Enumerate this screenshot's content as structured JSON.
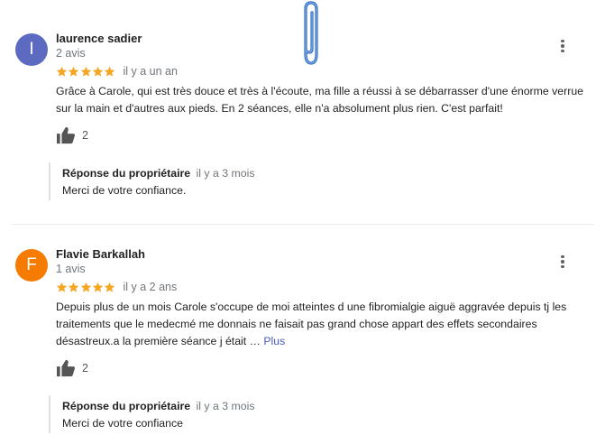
{
  "colors": {
    "avatar_1": "#5c6bc0",
    "avatar_2": "#f57c00",
    "stars": "#f5a623",
    "more_link": "#4b5ac2"
  },
  "reviews": [
    {
      "initial": "I",
      "author": "laurence sadier",
      "review_count": "2 avis",
      "rating": 5,
      "time": "il y a un an",
      "text": "Grâce à Carole, qui est très douce et très à l'écoute, ma fille a réussi à se débarrasser d'une énorme verrue sur la main et d'autres aux pieds. En 2 séances, elle n'a absolument plus rien. C'est parfait!",
      "more": "",
      "likes": "2",
      "reply": {
        "owner_label": "Réponse du propriétaire",
        "time": "il y a 3 mois",
        "text": "Merci de votre confiance."
      }
    },
    {
      "initial": "F",
      "author": "Flavie Barkallah",
      "review_count": "1 avis",
      "rating": 5,
      "time": "il y a 2 ans",
      "text": "Depuis plus de un mois Carole s'occupe de moi atteintes d une fibromialgie aiguë aggravée depuis tj les traitements que le medecmé me donnais ne faisait pas grand chose appart des effets secondaires désastreux.a la première séance j était …",
      "more": "Plus",
      "likes": "2",
      "reply": {
        "owner_label": "Réponse du propriétaire",
        "time": "il y a 3 mois",
        "text": "Merci de votre confiance"
      }
    }
  ],
  "icons": {
    "menu": "more-vert-icon",
    "like": "thumb-up-icon",
    "star": "star-icon",
    "paperclip": "paperclip-icon"
  }
}
